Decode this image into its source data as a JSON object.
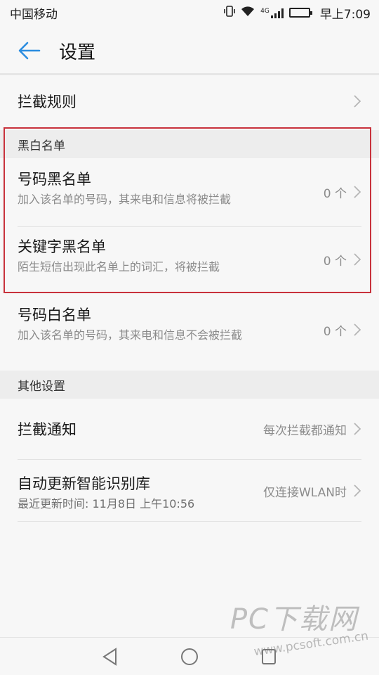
{
  "status_bar": {
    "carrier": "中国移动",
    "network": "4G",
    "time": "早上7:09"
  },
  "header": {
    "title": "设置"
  },
  "rows": {
    "intercept_rules": {
      "title": "拦截规则"
    },
    "blacklist_section": "黑白名单",
    "number_blacklist": {
      "title": "号码黑名单",
      "subtitle": "加入该名单的号码，其来电和信息将被拦截",
      "count": "0 个"
    },
    "keyword_blacklist": {
      "title": "关键字黑名单",
      "subtitle": "陌生短信出现此名单上的词汇，将被拦截",
      "count": "0 个"
    },
    "number_whitelist": {
      "title": "号码白名单",
      "subtitle": "加入该名单的号码，其来电和信息不会被拦截",
      "count": "0 个"
    },
    "other_section": "其他设置",
    "intercept_notify": {
      "title": "拦截通知",
      "value": "每次拦截都通知"
    },
    "auto_update": {
      "title": "自动更新智能识别库",
      "subtitle": "最近更新时间: 11月8日 上午10:56",
      "value": "仅连接WLAN时"
    }
  },
  "watermark": {
    "brand": "PC下载网",
    "url": "www.pcsoft.com.cn"
  },
  "colors": {
    "accent": "#2b8de0",
    "highlight_border": "#c8323c",
    "background": "#f7f7f7"
  }
}
